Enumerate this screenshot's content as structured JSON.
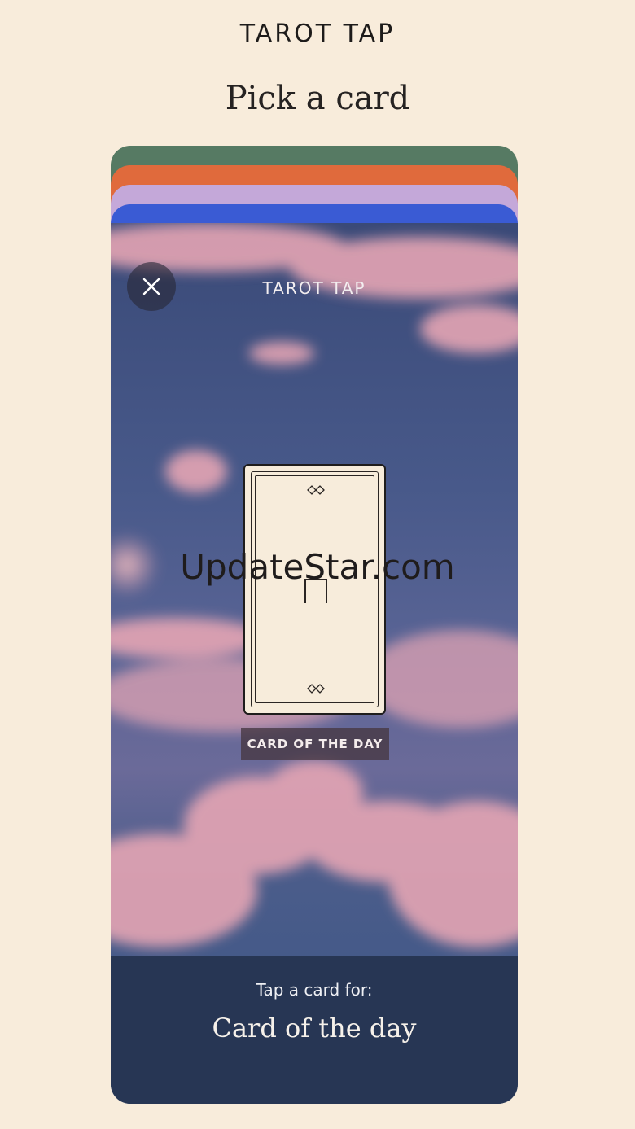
{
  "app": {
    "brand": "TAROT TAP",
    "headline": "Pick a card"
  },
  "deck_colors": {
    "green": "#567a63",
    "orange": "#e06a3c",
    "lavender": "#c4a8d9",
    "blue": "#3a5bd4"
  },
  "card_view": {
    "title": "TAROT TAP",
    "close_icon": "close-icon",
    "badge": "CARD OF THE DAY",
    "prompt": "Tap a card for:",
    "selection": "Card of the day"
  },
  "watermark": "UpdateStar.com"
}
